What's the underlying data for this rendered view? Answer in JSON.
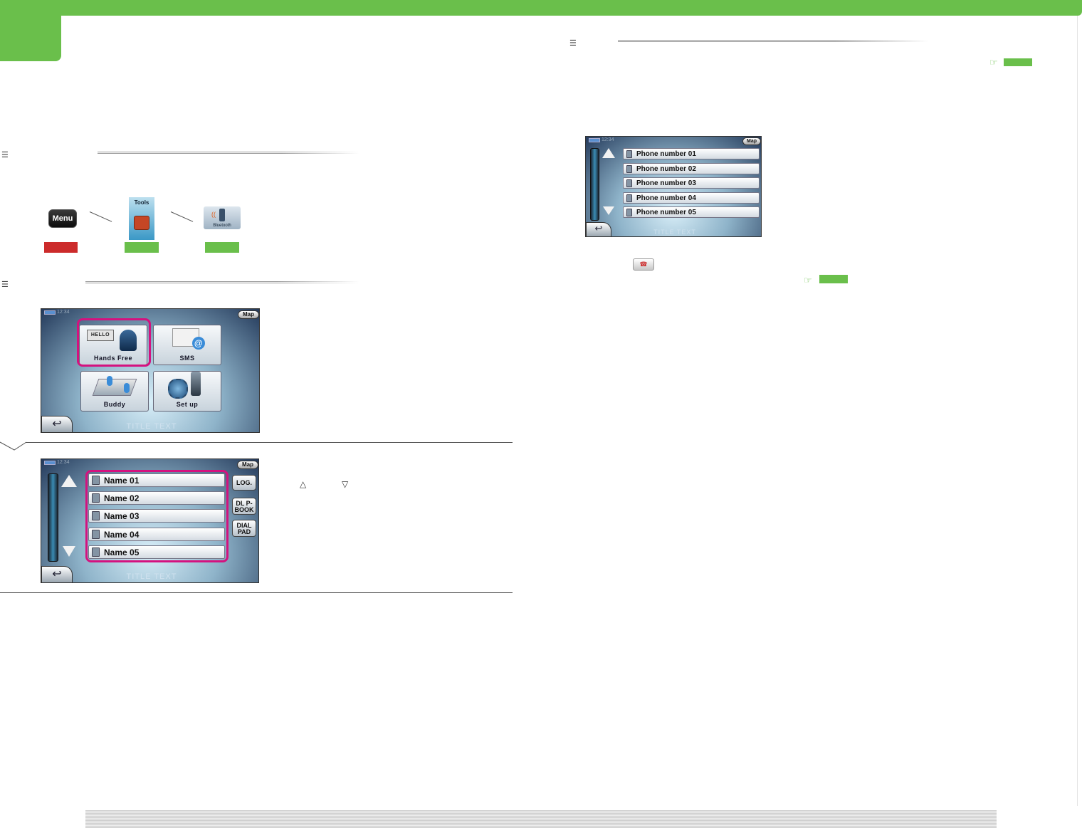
{
  "procedure": {
    "menu_label": "Menu",
    "tools_label": "Tools",
    "bluetooth_label": "Bluetooth"
  },
  "screen_menu": {
    "clock": "12:34",
    "map_label": "Map",
    "tiles": [
      "Hands Free",
      "SMS",
      "Buddy",
      "Set up"
    ],
    "hello_bubble": "HELLO",
    "title": "TITLE TEXT"
  },
  "screen_names": {
    "clock": "12:34",
    "map_label": "Map",
    "names": [
      "Name 01",
      "Name 02",
      "Name 03",
      "Name 04",
      "Name 05"
    ],
    "side_buttons": [
      "LOG.",
      "DL P-BOOK",
      "DIAL PAD"
    ],
    "title": "TITLE TEXT"
  },
  "screen_numbers": {
    "clock": "12:34",
    "map_label": "Map",
    "numbers": [
      "Phone number 01",
      "Phone number 02",
      "Phone number 03",
      "Phone number 04",
      "Phone number 05"
    ],
    "title": "TITLE TEXT"
  },
  "symbols": {
    "up_triangle": "△",
    "down_triangle": "▽",
    "reference_hand": "☞"
  },
  "colors": {
    "brand_green": "#6abf4b",
    "alert_red": "#cc2b2b",
    "highlight_magenta": "#d4127f"
  }
}
